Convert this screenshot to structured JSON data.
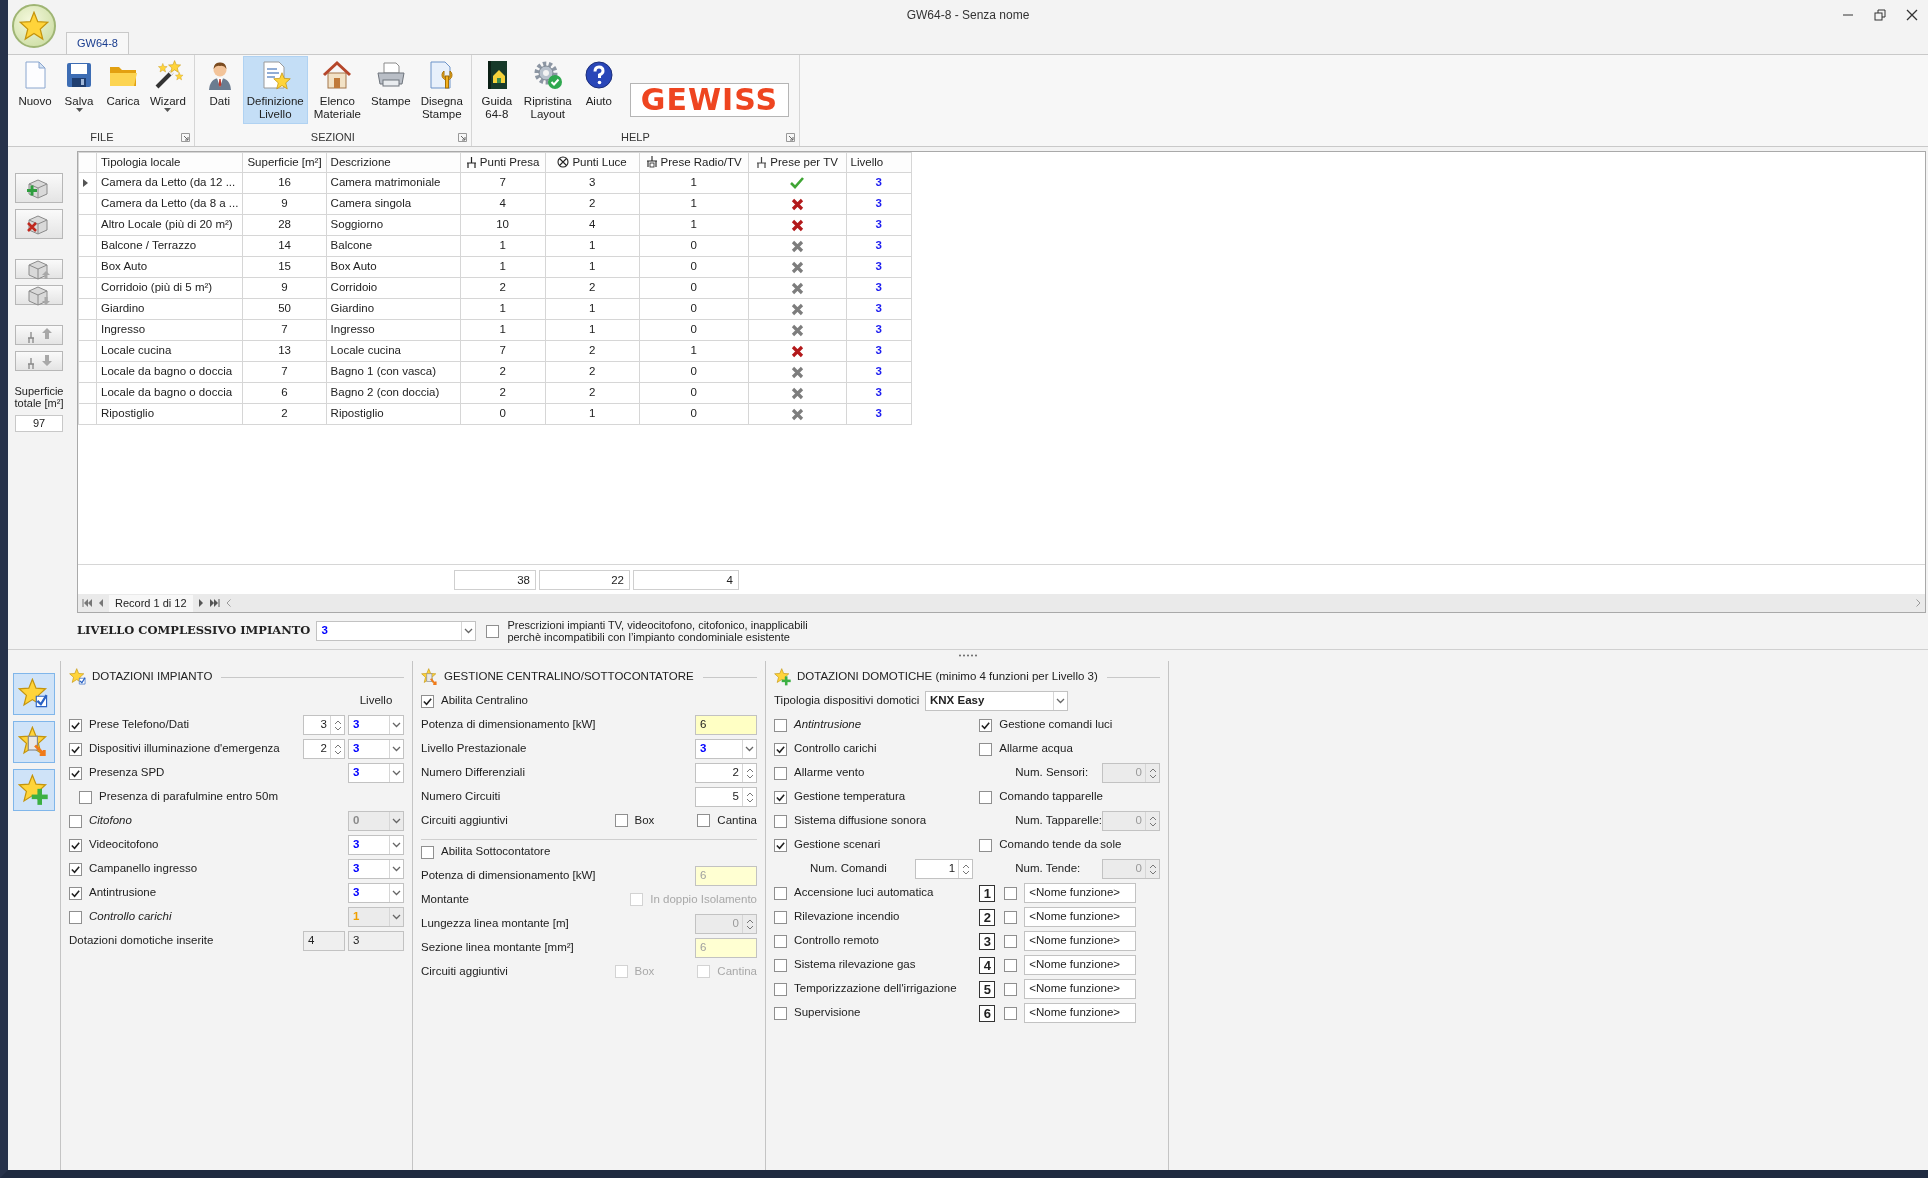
{
  "window": {
    "title": "GW64-8 - Senza nome"
  },
  "ribbon": {
    "tabs": [
      {
        "label": "GW64-8",
        "selected": true
      }
    ],
    "groups": [
      {
        "label": "FILE",
        "buttons": [
          {
            "label": "Nuovo",
            "kind": "new",
            "dropdown": false,
            "selected": false
          },
          {
            "label": "Salva",
            "kind": "save",
            "dropdown": true,
            "selected": false
          },
          {
            "label": "Carica",
            "kind": "load",
            "dropdown": false,
            "selected": false
          },
          {
            "label": "Wizard",
            "kind": "wizard",
            "dropdown": true,
            "selected": false
          }
        ]
      },
      {
        "label": "SEZIONI",
        "buttons": [
          {
            "label": "Dati",
            "kind": "person",
            "dropdown": false,
            "selected": false
          },
          {
            "label": "Definizione Livello",
            "kind": "level",
            "dropdown": false,
            "selected": true
          },
          {
            "label": "Elenco Materiale",
            "kind": "materials",
            "dropdown": false,
            "selected": false
          },
          {
            "label": "Stampe",
            "kind": "print",
            "dropdown": false,
            "selected": false
          },
          {
            "label": "Disegna Stampe",
            "kind": "draw",
            "dropdown": false,
            "selected": false
          }
        ]
      },
      {
        "label": "HELP",
        "buttons": [
          {
            "label": "Guida 64-8",
            "kind": "guide",
            "dropdown": false,
            "selected": false
          },
          {
            "label": "Ripristina Layout",
            "kind": "reset",
            "dropdown": false,
            "selected": false
          },
          {
            "label": "Aiuto",
            "kind": "help",
            "dropdown": false,
            "selected": false
          }
        ],
        "logo": "GEWISS"
      }
    ]
  },
  "surface_total": {
    "label": "Superficie totale [m²]",
    "value": "97"
  },
  "table": {
    "columns": [
      {
        "label": "Tipologia locale",
        "kind": "text"
      },
      {
        "label": "Superficie [m²]",
        "kind": "number"
      },
      {
        "label": "Descrizione",
        "kind": "text"
      },
      {
        "label": "Punti Presa",
        "kind": "socket"
      },
      {
        "label": "Punti Luce",
        "kind": "light"
      },
      {
        "label": "Prese Radio/TV",
        "kind": "radio"
      },
      {
        "label": "Prese per TV",
        "kind": "tv-status"
      },
      {
        "label": "Livello",
        "kind": "level"
      }
    ],
    "rows": [
      {
        "selected": true,
        "cells": [
          "Camera da Letto (da 12 ...",
          "16",
          "Camera matrimoniale",
          "7",
          "3",
          "1",
          "3"
        ],
        "tv_required": true,
        "tv_present": true
      },
      {
        "selected": false,
        "cells": [
          "Camera da Letto (da 8 a ...",
          "9",
          "Camera singola",
          "4",
          "2",
          "1",
          "3"
        ],
        "tv_required": true,
        "tv_present": false
      },
      {
        "selected": false,
        "cells": [
          "Altro Locale (più di 20 m²)",
          "28",
          "Soggiorno",
          "10",
          "4",
          "1",
          "3"
        ],
        "tv_required": true,
        "tv_present": false
      },
      {
        "selected": false,
        "cells": [
          "Balcone / Terrazzo",
          "14",
          "Balcone",
          "1",
          "1",
          "0",
          "3"
        ],
        "tv_required": false,
        "tv_present": false
      },
      {
        "selected": false,
        "cells": [
          "Box Auto",
          "15",
          "Box Auto",
          "1",
          "1",
          "0",
          "3"
        ],
        "tv_required": false,
        "tv_present": false
      },
      {
        "selected": false,
        "cells": [
          "Corridoio (più di 5 m²)",
          "9",
          "Corridoio",
          "2",
          "2",
          "0",
          "3"
        ],
        "tv_required": false,
        "tv_present": false
      },
      {
        "selected": false,
        "cells": [
          "Giardino",
          "50",
          "Giardino",
          "1",
          "1",
          "0",
          "3"
        ],
        "tv_required": false,
        "tv_present": false
      },
      {
        "selected": false,
        "cells": [
          "Ingresso",
          "7",
          "Ingresso",
          "1",
          "1",
          "0",
          "3"
        ],
        "tv_required": false,
        "tv_present": false
      },
      {
        "selected": false,
        "cells": [
          "Locale cucina",
          "13",
          "Locale cucina",
          "7",
          "2",
          "1",
          "3"
        ],
        "tv_required": true,
        "tv_present": false
      },
      {
        "selected": false,
        "cells": [
          "Locale da bagno o doccia",
          "7",
          "Bagno 1 (con vasca)",
          "2",
          "2",
          "0",
          "3"
        ],
        "tv_required": false,
        "tv_present": false
      },
      {
        "selected": false,
        "cells": [
          "Locale da bagno o doccia",
          "6",
          "Bagno 2 (con doccia)",
          "2",
          "2",
          "0",
          "3"
        ],
        "tv_required": false,
        "tv_present": false
      },
      {
        "selected": false,
        "cells": [
          "Ripostiglio",
          "2",
          "Ripostiglio",
          "0",
          "1",
          "0",
          "3"
        ],
        "tv_required": false,
        "tv_present": false
      }
    ],
    "totals": [
      "38",
      "22",
      "4"
    ],
    "navigator": "Record 1 di 12"
  },
  "overall": {
    "label": "LIVELLO COMPLESSIVO IMPIANTO",
    "value": "3",
    "color": "#0000ff",
    "note_checked": false,
    "note": "Prescrizioni impianti TV, videocitofono, citofonico, inapplicabili perchè incompatibili con l’impianto condominiale esistente"
  },
  "equipment": {
    "title": "DOTAZIONI IMPIANTO",
    "level_header": "Livello",
    "rows": [
      {
        "kind": "check",
        "label": "Prese Telefono/Dati",
        "checked": true,
        "italic": false,
        "controls": [
          {
            "kind": "spin",
            "value": "3",
            "disabled": false
          },
          {
            "kind": "combo",
            "value": "3",
            "color": "#0000ff",
            "disabled": false
          }
        ]
      },
      {
        "kind": "check",
        "label": "Dispositivi illuminazione d'emergenza",
        "checked": true,
        "italic": false,
        "controls": [
          {
            "kind": "spin",
            "value": "2",
            "disabled": false
          },
          {
            "kind": "combo",
            "value": "3",
            "color": "#0000ff",
            "disabled": false
          }
        ]
      },
      {
        "kind": "check",
        "label": "Presenza SPD",
        "checked": true,
        "italic": false,
        "controls": [
          {
            "kind": "combo",
            "value": "3",
            "color": "#0000ff",
            "disabled": false
          }
        ]
      },
      {
        "kind": "subcheck",
        "label": "Presenza di parafulmine entro 50m",
        "checked": false,
        "italic": false
      },
      {
        "kind": "check",
        "label": "Citofono",
        "checked": false,
        "italic": true,
        "controls": [
          {
            "kind": "combo",
            "value": "0",
            "color": "#8a8a8a",
            "disabled": true
          }
        ]
      },
      {
        "kind": "check",
        "label": "Videocitofono",
        "checked": true,
        "italic": false,
        "controls": [
          {
            "kind": "combo",
            "value": "3",
            "color": "#0000ff",
            "disabled": false
          }
        ]
      },
      {
        "kind": "check",
        "label": "Campanello ingresso",
        "checked": true,
        "italic": false,
        "controls": [
          {
            "kind": "combo",
            "value": "3",
            "color": "#0000ff",
            "disabled": false
          }
        ]
      },
      {
        "kind": "check",
        "label": "Antintrusione",
        "checked": true,
        "italic": false,
        "controls": [
          {
            "kind": "combo",
            "value": "3",
            "color": "#0000ff",
            "disabled": false
          }
        ]
      },
      {
        "kind": "check",
        "label": "Controllo carichi",
        "checked": false,
        "italic": true,
        "controls": [
          {
            "kind": "combo",
            "value": "1",
            "color": "#f0a000",
            "disabled": true
          }
        ]
      },
      {
        "kind": "text",
        "label": "Dotazioni domotiche inserite",
        "controls": [
          {
            "kind": "readonly",
            "value": "4"
          },
          {
            "kind": "readonly-wide",
            "value": "3"
          }
        ]
      }
    ]
  },
  "switchboard": {
    "title": "GESTIONE CENTRALINO/SOTTOCONTATORE",
    "sections": [
      {
        "rows": [
          {
            "kind": "check",
            "label": "Abilita Centralino",
            "checked": true,
            "italic": false
          },
          {
            "kind": "text",
            "label": "Potenza di dimensionamento [kW]",
            "controls": [
              {
                "kind": "field",
                "value": "6",
                "highlight": true,
                "disabled": false
              }
            ]
          },
          {
            "kind": "text",
            "label": "Livello Prestazionale",
            "controls": [
              {
                "kind": "combo",
                "value": "3",
                "color": "#0000ff",
                "disabled": false
              }
            ]
          },
          {
            "kind": "text",
            "label": "Numero Differenziali",
            "controls": [
              {
                "kind": "spin",
                "value": "2",
                "disabled": false
              }
            ]
          },
          {
            "kind": "text",
            "label": "Numero Circuiti",
            "controls": [
              {
                "kind": "spin",
                "value": "5",
                "disabled": false
              }
            ]
          },
          {
            "kind": "text",
            "label": "Circuiti aggiuntivi",
            "controls": [
              {
                "kind": "check",
                "label": "Box",
                "checked": false,
                "disabled": false
              },
              {
                "kind": "check",
                "label": "Cantina",
                "checked": false,
                "disabled": false
              }
            ]
          }
        ]
      },
      {
        "rows": [
          {
            "kind": "check",
            "label": "Abilita Sottocontatore",
            "checked": false,
            "italic": false
          },
          {
            "kind": "text",
            "label": "Potenza di dimensionamento [kW]",
            "controls": [
              {
                "kind": "field",
                "value": "6",
                "highlight": true,
                "disabled": true
              }
            ]
          },
          {
            "kind": "text",
            "label": "Montante",
            "controls": [
              {
                "kind": "check",
                "label": "In doppio Isolamento",
                "checked": false,
                "disabled": true
              }
            ]
          },
          {
            "kind": "text",
            "label": "Lungezza linea montante [m]",
            "controls": [
              {
                "kind": "spin",
                "value": "0",
                "disabled": true
              }
            ]
          },
          {
            "kind": "text",
            "label": "Sezione linea montante [mm²]",
            "controls": [
              {
                "kind": "field",
                "value": "6",
                "highlight": true,
                "disabled": true
              }
            ]
          },
          {
            "kind": "text",
            "label": "Circuiti aggiuntivi",
            "controls": [
              {
                "kind": "check",
                "label": "Box",
                "checked": false,
                "disabled": true
              },
              {
                "kind": "check",
                "label": "Cantina",
                "checked": false,
                "disabled": true
              }
            ]
          }
        ]
      }
    ]
  },
  "domotics": {
    "title": "DOTAZIONI DOMOTICHE (minimo 4 funzioni per Livello 3)",
    "type_label": "Tipologia dispositivi domotici",
    "type_value": "KNX Easy",
    "left": [
      {
        "label": "Antintrusione",
        "checked": false,
        "italic": true
      },
      {
        "label": "Controllo carichi",
        "checked": true,
        "italic": false
      },
      {
        "label": "Allarme vento",
        "checked": false,
        "italic": false
      },
      {
        "label": "Gestione temperatura",
        "checked": true,
        "italic": false
      },
      {
        "label": "Sistema diffusione sonora",
        "checked": false,
        "italic": false
      },
      {
        "label": "Gestione scenari",
        "checked": true,
        "italic": false,
        "sub": {
          "label": "Num. Comandi",
          "value": "1",
          "disabled": false
        }
      },
      {
        "label": "Accensione luci automatica",
        "checked": false,
        "italic": false
      },
      {
        "label": "Rilevazione incendio",
        "checked": false,
        "italic": false
      },
      {
        "label": "Controllo remoto",
        "checked": false,
        "italic": false
      },
      {
        "label": "Sistema rilevazione gas",
        "checked": false,
        "italic": false
      },
      {
        "label": "Temporizzazione dell'irrigazione",
        "checked": false,
        "italic": false
      },
      {
        "label": "Supervisione",
        "checked": false,
        "italic": false
      }
    ],
    "right": [
      {
        "label": "Gestione comandi luci",
        "checked": true
      },
      {
        "label": "Allarme acqua",
        "checked": false,
        "sub": {
          "label": "Num. Sensori:",
          "value": "0",
          "disabled": true
        }
      },
      {
        "label": "Comando tapparelle",
        "checked": false,
        "sub": {
          "label": "Num. Tapparelle:",
          "value": "0",
          "disabled": true
        }
      },
      {
        "label": "Comando tende da sole",
        "checked": false,
        "sub": {
          "label": "Num. Tende:",
          "value": "0",
          "disabled": true
        }
      }
    ],
    "functions": [
      {
        "number": "1",
        "checked": false,
        "value": "<Nome funzione>"
      },
      {
        "number": "2",
        "checked": false,
        "value": "<Nome funzione>"
      },
      {
        "number": "3",
        "checked": false,
        "value": "<Nome funzione>"
      },
      {
        "number": "4",
        "checked": false,
        "value": "<Nome funzione>"
      },
      {
        "number": "5",
        "checked": false,
        "value": "<Nome funzione>"
      },
      {
        "number": "6",
        "checked": false,
        "value": "<Nome funzione>"
      }
    ]
  }
}
